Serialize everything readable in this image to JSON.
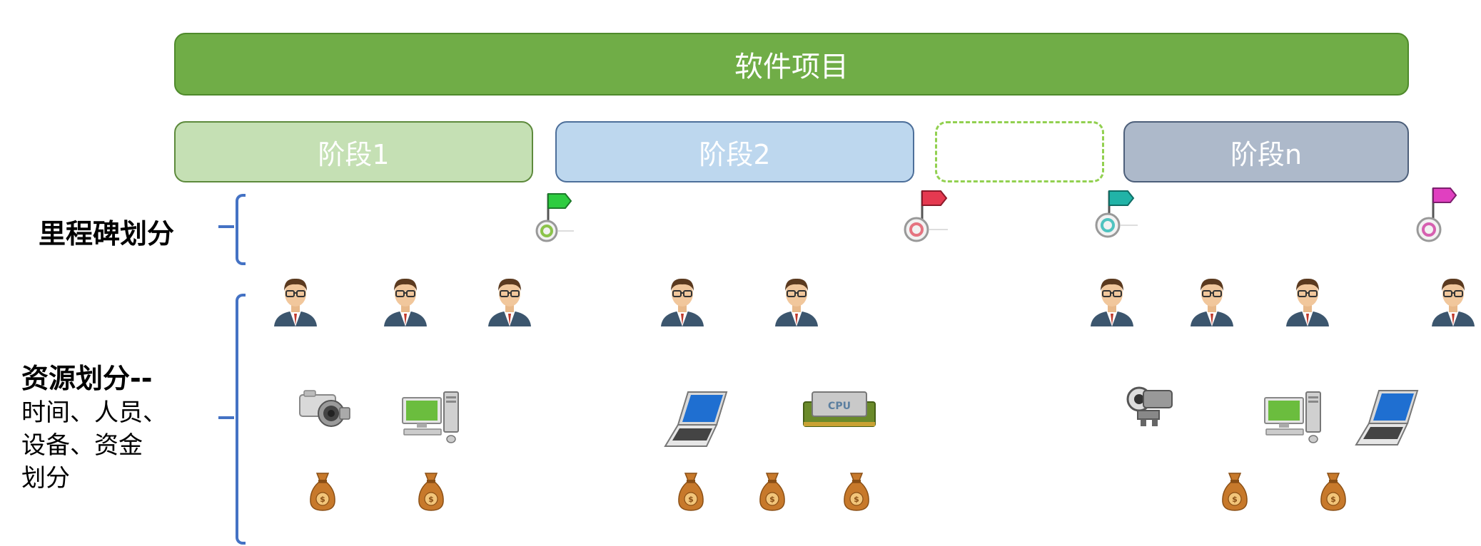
{
  "project": {
    "label": "软件项目"
  },
  "stages": [
    {
      "label": "阶段1"
    },
    {
      "label": "阶段2"
    },
    {
      "label": ""
    },
    {
      "label": "阶段n"
    }
  ],
  "milestone_section": {
    "label": "里程碑划分"
  },
  "resource_section": {
    "title": "资源划分--",
    "lines": [
      "时间、人员、",
      "设备、资金",
      "划分"
    ]
  },
  "colors": {
    "project": "#70ad47",
    "stage1": "#c5e0b4",
    "stage2": "#bdd7ee",
    "stage_n": "#adb9ca",
    "bracket": "#4472c4",
    "money_bag": "#c7792b"
  },
  "milestones": [
    {
      "flag_color": "#2ecc40",
      "ring_color": "#8bc34a"
    },
    {
      "flag_color": "#e53950",
      "ring_color": "#e57380"
    },
    {
      "flag_color": "#21b3a7",
      "ring_color": "#4fc3c0"
    },
    {
      "flag_color": "#e040c0",
      "ring_color": "#d660b0"
    }
  ],
  "icons": {
    "person": "person-icon",
    "camera": "camera-icon",
    "desktop": "desktop-computer-icon",
    "laptop": "laptop-icon",
    "cpu": "cpu-chip-icon",
    "projector": "projector-icon",
    "money": "money-bag-icon",
    "flag": "milestone-flag-icon"
  },
  "cpu_label": "CPU",
  "money_symbol": "$"
}
